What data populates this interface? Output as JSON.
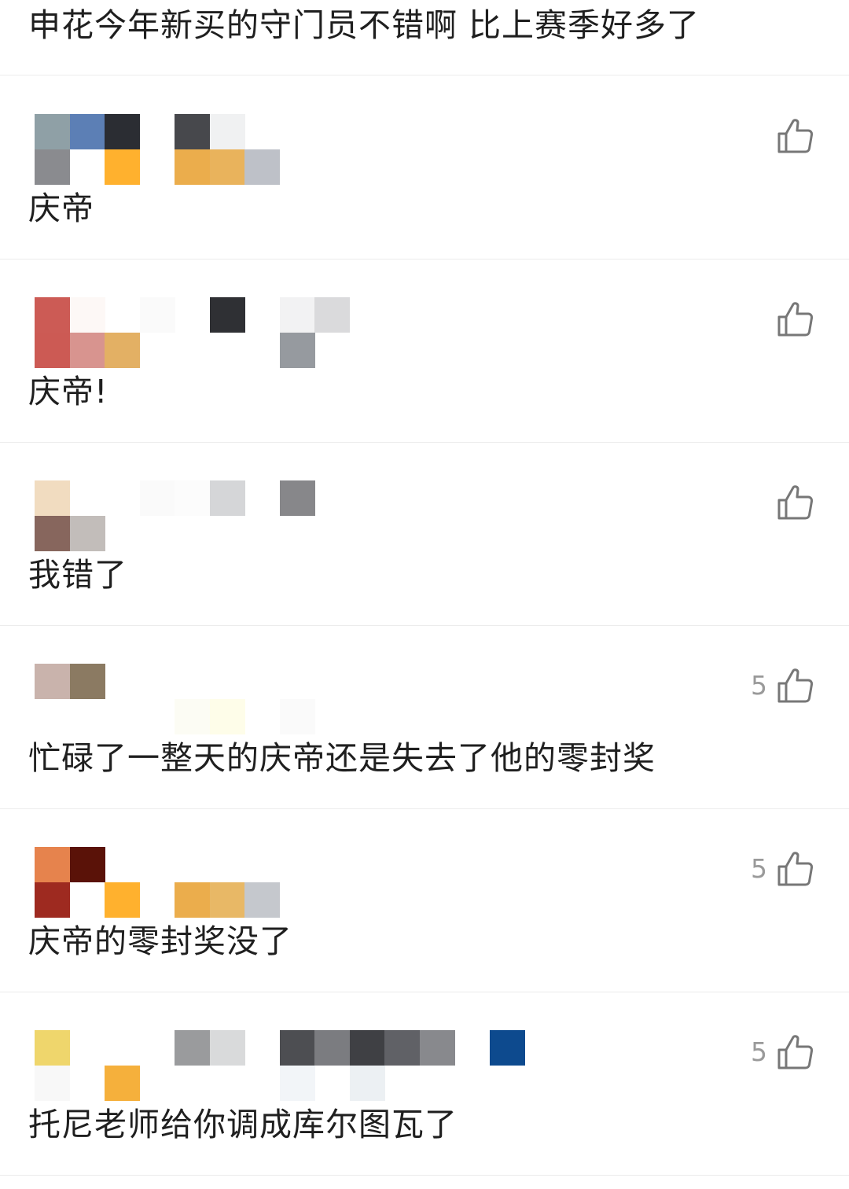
{
  "top_comment": {
    "text": "申花今年新买的守门员不错啊 比上赛季好多了"
  },
  "comments": [
    {
      "text": "庆帝",
      "likes": "",
      "mosaic": [
        [
          "#8fa0a6",
          0,
          0
        ],
        [
          "#5c7fb5",
          1,
          0
        ],
        [
          "#2b2d33",
          2,
          0
        ],
        [
          "#8a8b8f",
          0,
          1
        ],
        [
          "#ffb12e",
          2,
          1
        ],
        [
          "#47484c",
          4,
          0
        ],
        [
          "#f0f1f2",
          5,
          0
        ],
        [
          "#ebad4c",
          4,
          1
        ],
        [
          "#e9b35c",
          5,
          1
        ],
        [
          "#bec1c8",
          6,
          1
        ]
      ]
    },
    {
      "text": "庆帝!",
      "likes": "",
      "mosaic": [
        [
          "#cc5b55",
          0,
          0
        ],
        [
          "#fdf8f6",
          1,
          0
        ],
        [
          "#fafafa",
          3,
          0
        ],
        [
          "#cc5a54",
          0,
          1
        ],
        [
          "#d8948f",
          1,
          1
        ],
        [
          "#e3b064",
          2,
          1
        ],
        [
          "#2f3034",
          5,
          0
        ],
        [
          "#f2f2f3",
          7,
          0
        ],
        [
          "#dadadc",
          8,
          0
        ],
        [
          "#969a9f",
          7,
          1
        ]
      ]
    },
    {
      "text": "我错了",
      "likes": "",
      "mosaic": [
        [
          "#f1dcc0",
          0,
          0
        ],
        [
          "#87665d",
          0,
          1
        ],
        [
          "#c2bdba",
          1,
          1
        ],
        [
          "#fafafa",
          3,
          0
        ],
        [
          "#fcfcfc",
          4,
          0
        ],
        [
          "#d5d6d8",
          5,
          0
        ],
        [
          "#87878a",
          7,
          0
        ]
      ]
    },
    {
      "text": "忙碌了一整天的庆帝还是失去了他的零封奖",
      "likes": "5",
      "mosaic": [
        [
          "#c9b3ac",
          0,
          0
        ],
        [
          "#8b7a62",
          1,
          0
        ],
        [
          "#fcfcf4",
          4,
          1
        ],
        [
          "#fefde9",
          5,
          1
        ],
        [
          "#fafafa",
          7,
          1
        ]
      ]
    },
    {
      "text": "庆帝的零封奖没了",
      "likes": "5",
      "mosaic": [
        [
          "#e6834d",
          0,
          0
        ],
        [
          "#5a1208",
          1,
          0
        ],
        [
          "#9e2a20",
          0,
          1
        ],
        [
          "#ffffff",
          1,
          1
        ],
        [
          "#ffb12e",
          2,
          1
        ],
        [
          "#ebad4c",
          4,
          1
        ],
        [
          "#e8b866",
          5,
          1
        ],
        [
          "#c5c8cd",
          6,
          1
        ]
      ]
    },
    {
      "text": "托尼老师给你调成库尔图瓦了",
      "likes": "5",
      "mosaic": [
        [
          "#efd66c",
          0,
          0
        ],
        [
          "#f8f8f8",
          0,
          1
        ],
        [
          "#f5b03c",
          2,
          1
        ],
        [
          "#9a9b9d",
          4,
          0
        ],
        [
          "#d9dadb",
          5,
          0
        ],
        [
          "#4d4e52",
          7,
          0
        ],
        [
          "#7b7c80",
          8,
          0
        ],
        [
          "#3f4044",
          9,
          0
        ],
        [
          "#606166",
          10,
          0
        ],
        [
          "#88898d",
          11,
          0
        ],
        [
          "#f2f5f8",
          7,
          1
        ],
        [
          "#ecf0f3",
          9,
          1
        ],
        [
          "#0d4a8e",
          13,
          0
        ]
      ]
    }
  ],
  "icons": {
    "like": "thumbs-up-icon"
  },
  "colors": {
    "text": "#1f1f1f",
    "muted": "#9a9a9a",
    "divider": "#ececec",
    "icon": "#777777"
  }
}
